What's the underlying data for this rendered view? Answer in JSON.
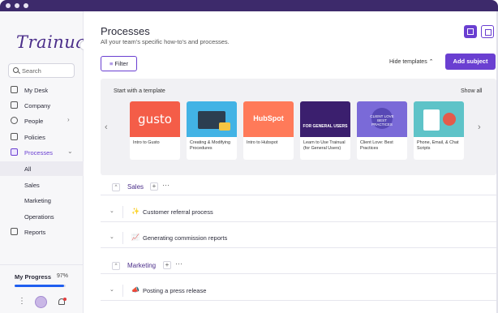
{
  "app": {
    "name": "Trainual"
  },
  "sidebar": {
    "logo": "Trainual",
    "collapse_icon": "chevron-right-icon",
    "search_placeholder": "Search",
    "nav": [
      {
        "label": "My Desk",
        "icon": "desk-icon"
      },
      {
        "label": "Company",
        "icon": "building-icon"
      },
      {
        "label": "People",
        "icon": "people-icon"
      },
      {
        "label": "Policies",
        "icon": "document-icon"
      },
      {
        "label": "Processes",
        "icon": "process-icon"
      }
    ],
    "subnav": [
      {
        "label": "All"
      },
      {
        "label": "Sales"
      },
      {
        "label": "Marketing"
      },
      {
        "label": "Operations"
      }
    ],
    "reports": {
      "label": "Reports",
      "icon": "report-icon"
    },
    "progress": {
      "label": "My Progress",
      "percent_text": "97%",
      "value": 0.97
    }
  },
  "header": {
    "title": "Processes",
    "subtitle": "All your team's specific how-to's and processes.",
    "filter_label": "Filter",
    "hide_templates_label": "Hide templates",
    "add_subject_label": "Add subject"
  },
  "templates": {
    "heading": "Start with a template",
    "show_all": "Show all",
    "cards": [
      {
        "caption": "Intro to Gusto",
        "thumb_text": "gusto",
        "color": "#f45d48"
      },
      {
        "caption": "Creating & Modifying Procedures",
        "thumb_text": "",
        "color": "#42b3e5"
      },
      {
        "caption": "Intro to Hubspot",
        "thumb_text": "HubSpot",
        "color": "#ff7a59"
      },
      {
        "caption": "Learn to Use Trainual (for General Users)",
        "thumb_text": "FOR GENERAL USERS",
        "color": "#3b1f6e"
      },
      {
        "caption": "Client Love: Best Practices",
        "thumb_text": "CLIENT LOVE BEST PRACTICES",
        "color": "#7a6ad8"
      },
      {
        "caption": "Phone, Email, & Chat Scripts",
        "thumb_text": "",
        "color": "#5ec3c8"
      }
    ]
  },
  "sections": [
    {
      "name": "Sales",
      "rows": [
        {
          "emoji": "✨",
          "title": "Customer referral process"
        },
        {
          "emoji": "📈",
          "title": "Generating commission reports"
        }
      ]
    },
    {
      "name": "Marketing",
      "rows": [
        {
          "emoji": "📣",
          "title": "Posting a press release"
        }
      ]
    }
  ]
}
